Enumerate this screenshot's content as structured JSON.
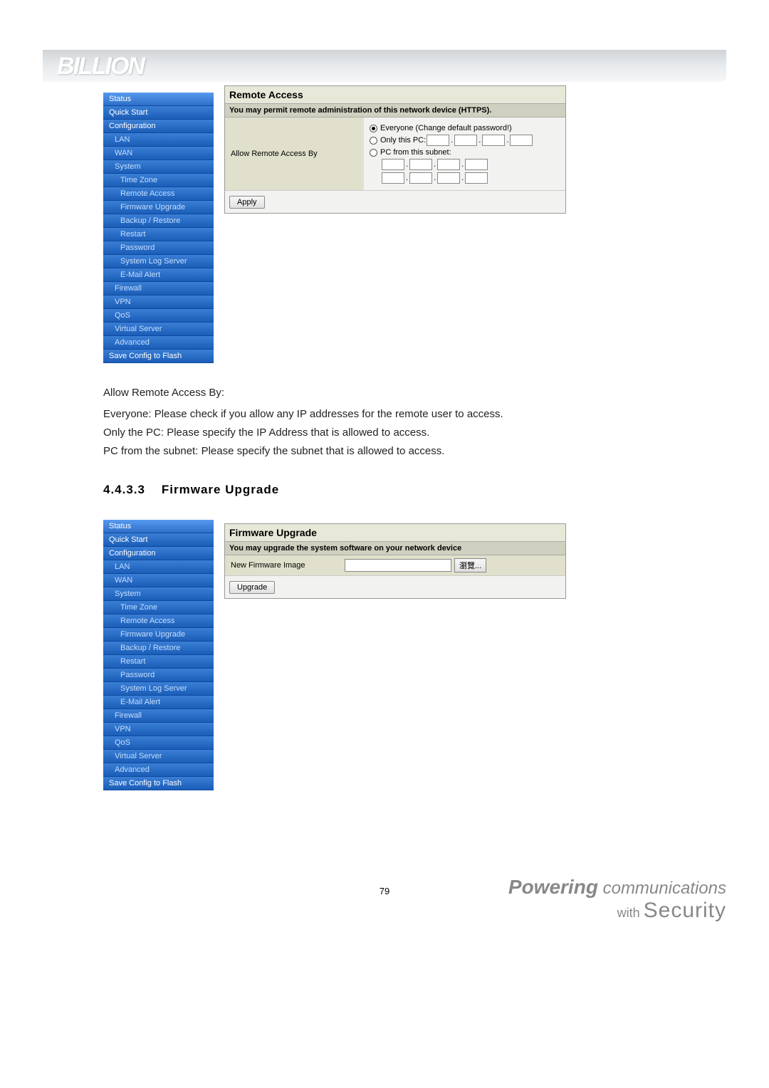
{
  "logo": "BILLION",
  "sidebar": {
    "items": [
      {
        "label": "Status",
        "cls": "highlight"
      },
      {
        "label": "Quick Start",
        "cls": ""
      },
      {
        "label": "Configuration",
        "cls": ""
      },
      {
        "label": "LAN",
        "cls": "sub"
      },
      {
        "label": "WAN",
        "cls": "sub"
      },
      {
        "label": "System",
        "cls": "sub"
      },
      {
        "label": "Time Zone",
        "cls": "sub2"
      },
      {
        "label": "Remote Access",
        "cls": "sub2"
      },
      {
        "label": "Firmware Upgrade",
        "cls": "sub2"
      },
      {
        "label": "Backup / Restore",
        "cls": "sub2"
      },
      {
        "label": "Restart",
        "cls": "sub2"
      },
      {
        "label": "Password",
        "cls": "sub2"
      },
      {
        "label": "System Log Server",
        "cls": "sub2"
      },
      {
        "label": "E-Mail Alert",
        "cls": "sub2"
      },
      {
        "label": "Firewall",
        "cls": "sub"
      },
      {
        "label": "VPN",
        "cls": "sub"
      },
      {
        "label": "QoS",
        "cls": "sub"
      },
      {
        "label": "Virtual Server",
        "cls": "sub"
      },
      {
        "label": "Advanced",
        "cls": "sub"
      },
      {
        "label": "Save Config to Flash",
        "cls": ""
      }
    ]
  },
  "remote_access": {
    "title": "Remote Access",
    "subtitle": "You may permit remote administration of this network device (HTTPS).",
    "row_label": "Allow Remote Access By",
    "opt_everyone": "Everyone (Change default password!)",
    "opt_only_pc": "Only this PC:",
    "opt_subnet": "PC from this subnet:",
    "apply": "Apply"
  },
  "firmware": {
    "title": "Firmware Upgrade",
    "subtitle": "You may upgrade the system software on your network device",
    "row_label": "New Firmware Image",
    "browse": "瀏覽...",
    "upgrade": "Upgrade"
  },
  "doc": {
    "line1": "Allow Remote Access By:",
    "line2": "Everyone: Please check if you allow any IP addresses for the remote user to access.",
    "line3": "Only the PC: Please specify the IP Address that is allowed to access.",
    "line4": "PC from the subnet: Please specify the subnet that is allowed to access.",
    "section_no": "4.4.3.3",
    "section_title": "Firmware Upgrade"
  },
  "page_number": "79",
  "footer": {
    "powering": "Powering",
    "communications": "communications",
    "with": "with",
    "security": "Security"
  }
}
